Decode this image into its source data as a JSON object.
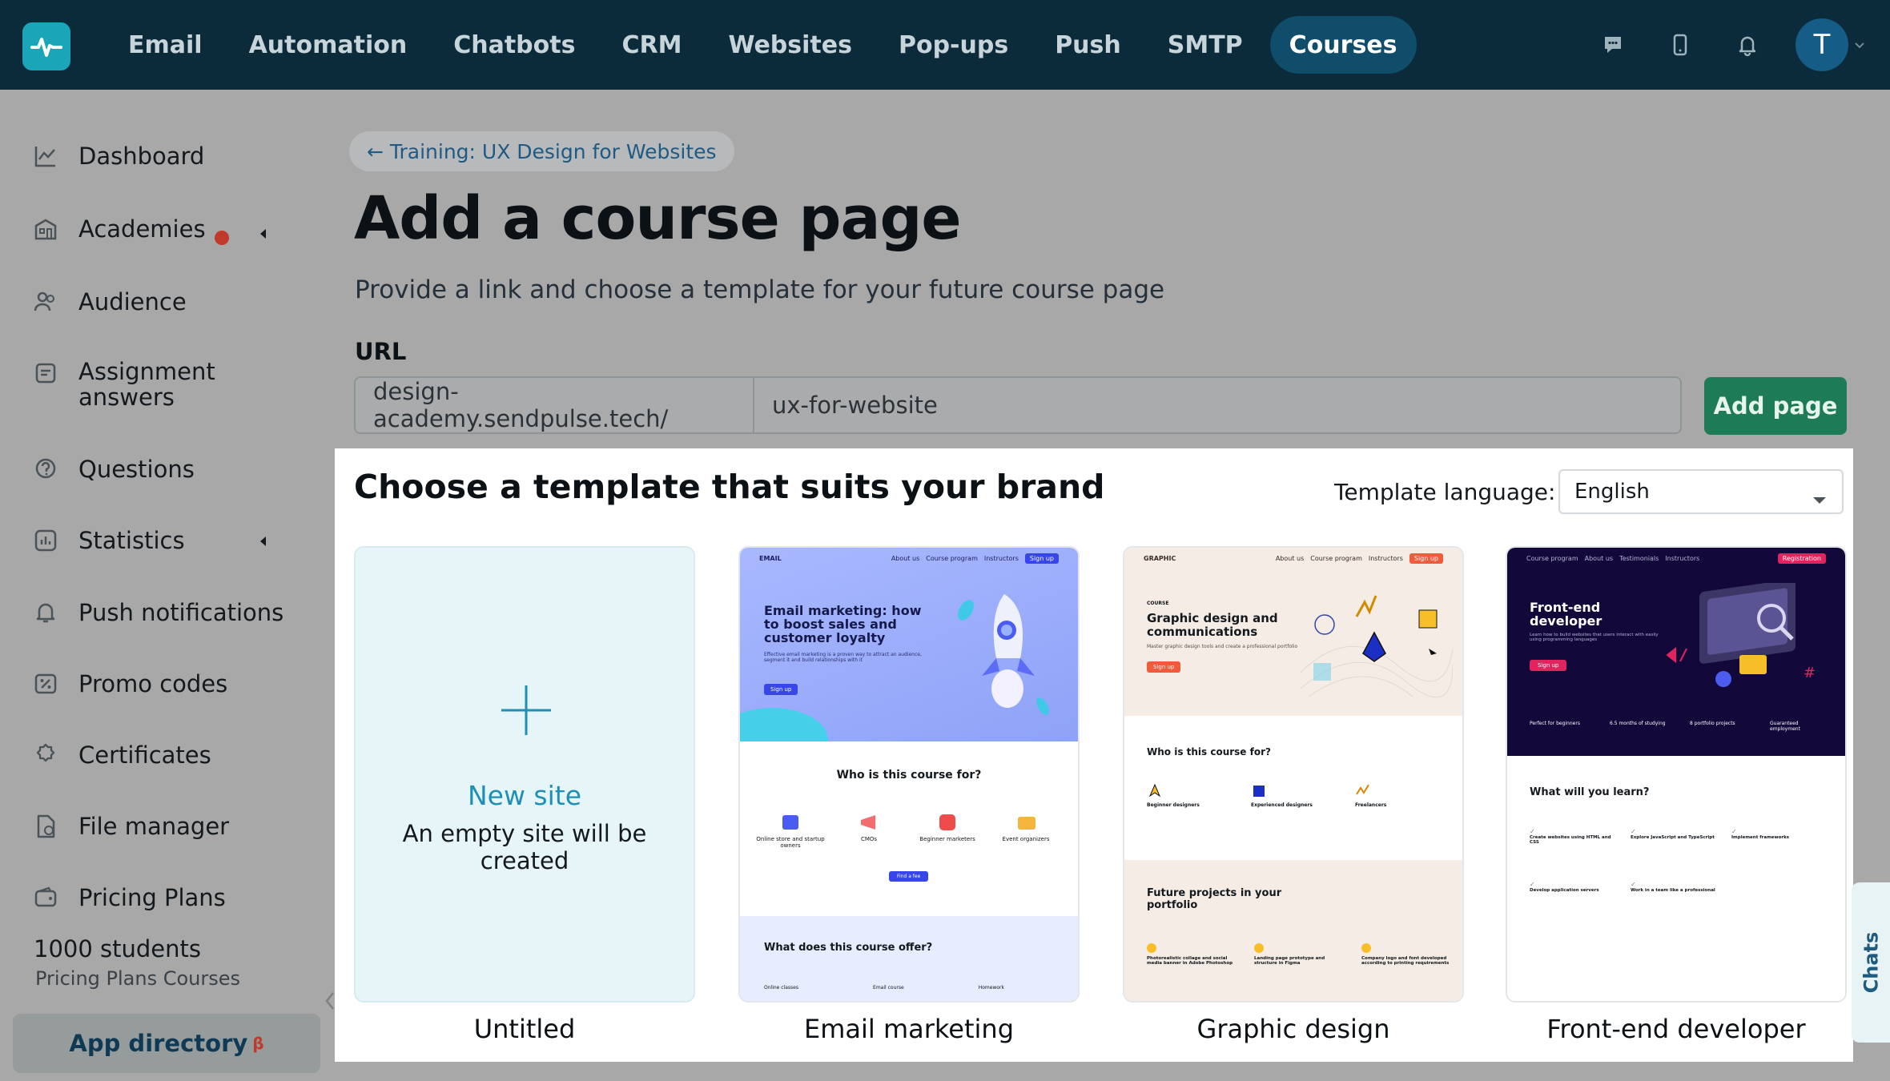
{
  "topnav": {
    "items": [
      "Email",
      "Automation",
      "Chatbots",
      "CRM",
      "Websites",
      "Pop-ups",
      "Push",
      "SMTP",
      "Courses"
    ],
    "active": "Courses",
    "avatar_letter": "T"
  },
  "sidebar": {
    "items": [
      "Dashboard",
      "Academies",
      "Audience",
      "Assignment answers",
      "Questions",
      "Statistics",
      "Push notifications",
      "Promo codes",
      "Certificates",
      "File manager",
      "Pricing Plans"
    ],
    "plan_title": "1000 students",
    "plan_sub": "Pricing Plans Courses",
    "app_directory": "App directory",
    "app_directory_badge": "β"
  },
  "main": {
    "back_link": "← Training: UX Design for Websites",
    "title": "Add a course page",
    "subtitle": "Provide a link and choose a template for your future course page",
    "url_label": "URL",
    "url_prefix": "design-academy.sendpulse.tech/",
    "url_value": "ux-for-website",
    "add_button": "Add page"
  },
  "templates": {
    "heading": "Choose a template that suits your brand",
    "language_label": "Template language:",
    "language_value": "English",
    "new_site_title": "New site",
    "new_site_sub": "An empty site will be created",
    "cards": [
      "Untitled",
      "Email marketing",
      "Graphic design",
      "Front-end developer"
    ]
  },
  "thumb_email": {
    "brand": "EMAIL",
    "nav": [
      "About us",
      "Course program",
      "Instructors"
    ],
    "signup": "Sign up",
    "headline": "Email marketing: how to boost sales and customer loyalty",
    "blurb": "Effective email marketing is a proven way to attract an audience, segment it and build relationships with it",
    "cta": "Sign up",
    "who": "Who is this course for?",
    "audiences": [
      "Online store and startup owners",
      "CMOs",
      "Beginner marketers",
      "Event organizers"
    ],
    "cta2": "Find a fee",
    "offer": "What does this course offer?",
    "offer_items": [
      "Online classes",
      "Email course",
      "Homework"
    ]
  },
  "thumb_graphic": {
    "brand": "GRAPHIC",
    "nav": [
      "About us",
      "Course program",
      "Instructors"
    ],
    "signup": "Sign up",
    "kicker": "COURSE",
    "headline": "Graphic design and communications",
    "blurb": "Master graphic design tools and create a professional portfolio",
    "cta": "Sign up",
    "who": "Who is this course for?",
    "audiences": [
      "Beginner designers",
      "Experienced designers",
      "Freelancers"
    ],
    "projects": "Future projects in your portfolio",
    "project_items": [
      "Photorealistic collage and social media banner in Adobe Photoshop",
      "Landing page prototype and structure in Figma",
      "Company logo and font developed according to printing requirements"
    ]
  },
  "thumb_frontend": {
    "nav": [
      "Course program",
      "About us",
      "Testimonials",
      "Instructors"
    ],
    "register": "Registration",
    "headline": "Front-end developer",
    "blurb": "Learn how to build websites that users interact with easily using programming languages",
    "cta": "Sign up",
    "stats": [
      "Perfect for beginners",
      "6.5 months of studying",
      "8 portfolio projects",
      "Guaranteed employment"
    ],
    "learn": "What will you learn?",
    "learn_items": [
      "Create websites using HTML and CSS",
      "Explore JavaScript and TypeScript",
      "Implement frameworks",
      "Develop application servers",
      "Work in a team like a professional"
    ]
  },
  "chats_tab": "Chats",
  "colors": {
    "topbar": "#0b2b3a",
    "active_tab": "#0f4d6b",
    "add_button": "#1d7c55",
    "accent": "#1f8fb5"
  }
}
